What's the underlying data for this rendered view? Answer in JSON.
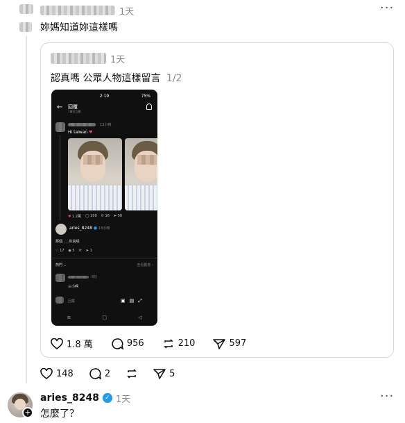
{
  "top_reply": {
    "time": "1天",
    "text": "妳媽知道妳這樣嗎",
    "stats": {
      "likes": "148",
      "replies": "2",
      "shares": "5"
    }
  },
  "quoted_post": {
    "time": "1天",
    "text": "認真嗎 公眾人物這樣留言",
    "page_counter": "1/2",
    "stats": {
      "likes": "1.8 萬",
      "replies": "956",
      "reposts": "210",
      "shares": "597"
    },
    "screenshot": {
      "status_time": "2:19",
      "status_battery": "75%",
      "header_title": "回覆",
      "header_sub": "1萬位互動",
      "reply_time": "13小時",
      "hi_text": "Hi taiwan",
      "post_acts": [
        "1.2萬",
        "100",
        "16",
        "50"
      ],
      "author_name": "aries_8248",
      "author_time": "13小時",
      "author_reply": "那個......你真噁",
      "reply_acts": [
        "17",
        "5",
        "",
        "1"
      ],
      "popular_label": "熱門",
      "view_activity": "查看動態",
      "sub_reply_time": "8分",
      "sub_reply_text": "三小啊",
      "input_hint": "回覆"
    }
  },
  "aries_reply": {
    "name": "aries_8248",
    "time": "1天",
    "text": "怎麼了？"
  },
  "icons": {
    "more": "more-dots-icon",
    "heart": "heart-icon",
    "comment": "comment-icon",
    "repost": "repost-icon",
    "share": "send-icon",
    "verified": "verified-badge-icon",
    "follow": "plus-icon"
  }
}
